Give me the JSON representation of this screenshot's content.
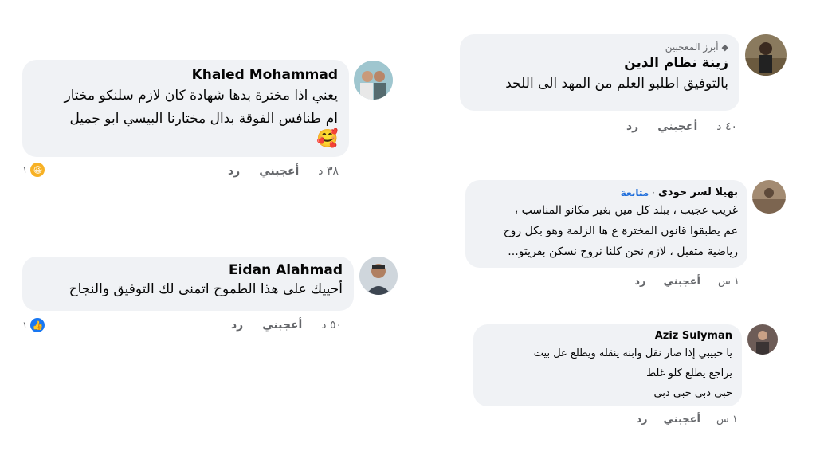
{
  "comments": [
    {
      "name": "زينة نظام الدين",
      "badge": "أبرز المعجبين",
      "text": "بالتوفيق اطلبو العلم من المهد الى اللحد",
      "time": "٤٠ د",
      "like": "أعجبني",
      "reply": "رد"
    },
    {
      "name": "Khaled Mohammad",
      "text": "يعني اذا مخترة بدها شهادة كان لازم سلنكو مختار\nام طنافس الفوقة بدال مختارنا البيسي ابو جميل",
      "time": "٣٨ د",
      "like": "أعجبني",
      "reply": "رد",
      "reaction_count": "١",
      "reaction": "haha"
    },
    {
      "name": "بهيلا لسر خودى",
      "follow": "متابعة",
      "text": "غريب عجيب ، ببلد كل مين بغير مكانو المناسب ،\nعم يطبقوا قانون المخترة ع ها الزلمة وهو بكل روح\nرياضية متقبل ، لازم نحن كلنا نروح نسكن بقريتو...",
      "time": "١ س",
      "like": "أعجبني",
      "reply": "رد"
    },
    {
      "name": "Eidan Alahmad",
      "text": "أحييك على هذا الطموح اتمنى لك التوفيق والنجاح",
      "time": "٥٠ د",
      "like": "أعجبني",
      "reply": "رد",
      "reaction_count": "١",
      "reaction": "like"
    },
    {
      "name": "Aziz Sulyman",
      "text": "يا حبيبي إذا صار نقل وابنه ينقله ويطلع عل بيت\nيراجع يطلع كلو غلط\nحبي دبي حبي دبي",
      "time": "١ س",
      "like": "أعجبني",
      "reply": "رد"
    }
  ],
  "colors": {
    "bubble": "#f0f2f5",
    "meta": "#65676b",
    "follow": "#216fdb",
    "like_reaction": "#1877f2",
    "haha_reaction": "#f7b125"
  },
  "icons": {
    "badge": "diamond-icon",
    "haha": "haha-reaction-icon",
    "like": "like-reaction-icon",
    "emoji": "smiling-face-with-hearts-emoji"
  }
}
